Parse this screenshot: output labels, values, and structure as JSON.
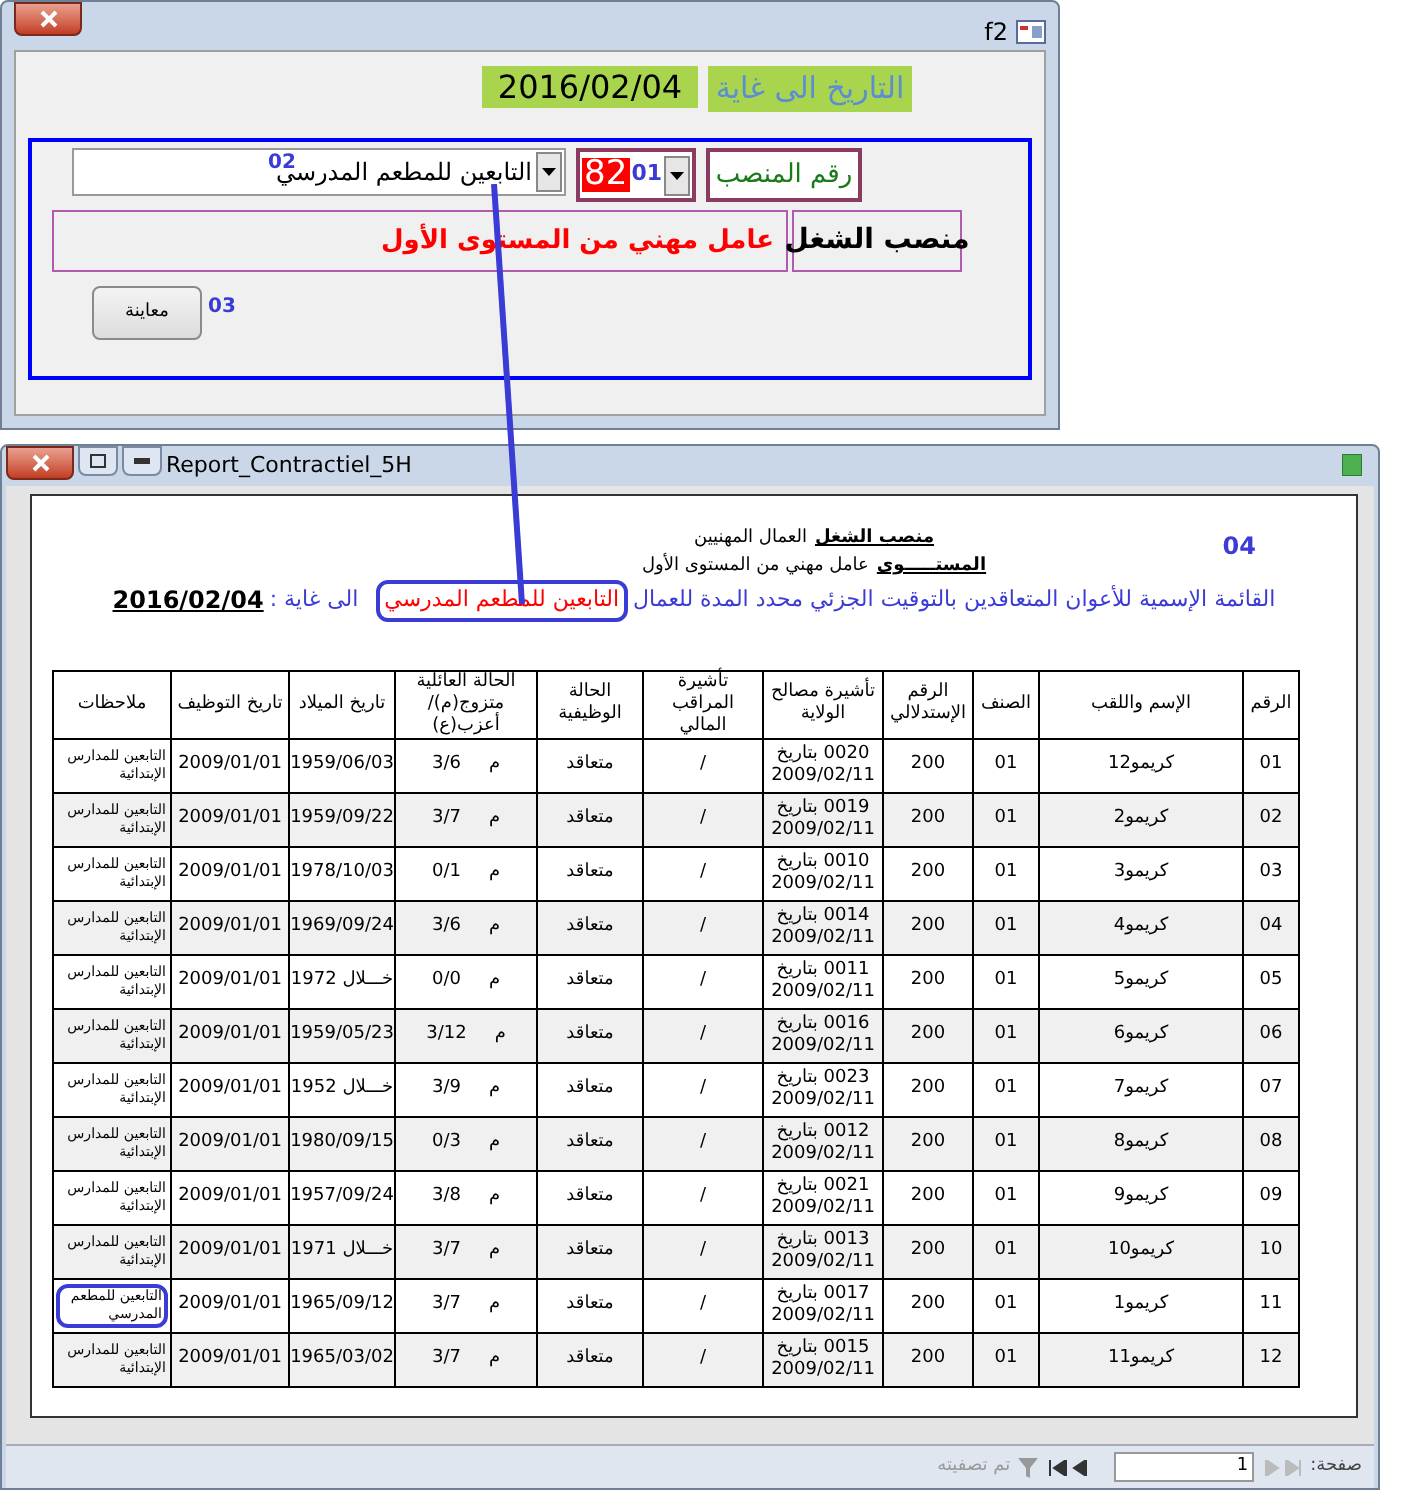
{
  "form_window": {
    "title": "f2",
    "date_label": "التاريخ الى غاية",
    "date": "2016/02/04",
    "post_number_label": "رقم المنصب",
    "post_number": "82",
    "post_code": "01",
    "category": "التابعين للمطعم المدرسي",
    "marker_category": "02",
    "job_label": "منصب الشغل",
    "job_value": "عامل مهني من المستوى الأول",
    "preview_button": "معاينة",
    "marker_button": "03"
  },
  "report_window": {
    "title": "Report_Contractiel_5H",
    "marker": "04",
    "header_lines": [
      {
        "label": "منصب الشغل",
        "value": "العمال المهنيين"
      },
      {
        "label": "المستـــــوى",
        "value": "عامل مهني من المستوى الأول"
      }
    ],
    "list_title": "القائمة الإسمية للأعوان المتعاقدين بالتوقيت الجزئي محدد المدة للعمال",
    "list_category": "التابعين للمطعم المدرسي",
    "category_highlighted": true,
    "until_label": "الى غاية :",
    "until_date": "2016/02/04",
    "table": {
      "columns": [
        "الرقم",
        "الإسم واللقب",
        "الصنف",
        "الرقم الإستدلالي",
        "تأشيرة مصالح الولاية",
        "تأشيرة المراقب المالي",
        "الحالة الوظيفية",
        "الحالة العائلية متزوج(م)/أعزب(ع)",
        "تاريخ الميلاد",
        "تاريخ التوظيف",
        "ملاحظات"
      ],
      "rows": [
        {
          "number": "01",
          "name": "كريمو12",
          "class": "01",
          "index": "200",
          "visa_wilaya": "0020 بتاريخ 2009/02/11",
          "visa_finance": "/",
          "status": "متعاقد",
          "marital": "م",
          "children": "3/6",
          "birth": "1959/06/03",
          "hired": "2009/01/01",
          "notes": "التابعين للمدارس الإبتدائية",
          "shaded": false,
          "highlighted": false
        },
        {
          "number": "02",
          "name": "كريمو2",
          "class": "01",
          "index": "200",
          "visa_wilaya": "0019 بتاريخ 2009/02/11",
          "visa_finance": "/",
          "status": "متعاقد",
          "marital": "م",
          "children": "3/7",
          "birth": "1959/09/22",
          "hired": "2009/01/01",
          "notes": "التابعين للمدارس الإبتدائية",
          "shaded": true,
          "highlighted": false
        },
        {
          "number": "03",
          "name": "كريمو3",
          "class": "01",
          "index": "200",
          "visa_wilaya": "0010 بتاريخ 2009/02/11",
          "visa_finance": "/",
          "status": "متعاقد",
          "marital": "م",
          "children": "0/1",
          "birth": "1978/10/03",
          "hired": "2009/01/01",
          "notes": "التابعين للمدارس الإبتدائية",
          "shaded": false,
          "highlighted": false
        },
        {
          "number": "04",
          "name": "كريمو4",
          "class": "01",
          "index": "200",
          "visa_wilaya": "0014 بتاريخ 2009/02/11",
          "visa_finance": "/",
          "status": "متعاقد",
          "marital": "م",
          "children": "3/6",
          "birth": "1969/09/24",
          "hired": "2009/01/01",
          "notes": "التابعين للمدارس الإبتدائية",
          "shaded": true,
          "highlighted": false
        },
        {
          "number": "05",
          "name": "كريمو5",
          "class": "01",
          "index": "200",
          "visa_wilaya": "0011 بتاريخ 2009/02/11",
          "visa_finance": "/",
          "status": "متعاقد",
          "marital": "م",
          "children": "0/0",
          "birth": "خـــلال 1972",
          "hired": "2009/01/01",
          "notes": "التابعين للمدارس الإبتدائية",
          "shaded": false,
          "highlighted": false
        },
        {
          "number": "06",
          "name": "كريمو6",
          "class": "01",
          "index": "200",
          "visa_wilaya": "0016 بتاريخ 2009/02/11",
          "visa_finance": "/",
          "status": "متعاقد",
          "marital": "م",
          "children": "3/12",
          "birth": "1959/05/23",
          "hired": "2009/01/01",
          "notes": "التابعين للمدارس الإبتدائية",
          "shaded": true,
          "highlighted": false
        },
        {
          "number": "07",
          "name": "كريمو7",
          "class": "01",
          "index": "200",
          "visa_wilaya": "0023 بتاريخ 2009/02/11",
          "visa_finance": "/",
          "status": "متعاقد",
          "marital": "م",
          "children": "3/9",
          "birth": "خـــلال 1952",
          "hired": "2009/01/01",
          "notes": "التابعين للمدارس الإبتدائية",
          "shaded": false,
          "highlighted": false
        },
        {
          "number": "08",
          "name": "كريمو8",
          "class": "01",
          "index": "200",
          "visa_wilaya": "0012 بتاريخ 2009/02/11",
          "visa_finance": "/",
          "status": "متعاقد",
          "marital": "م",
          "children": "0/3",
          "birth": "1980/09/15",
          "hired": "2009/01/01",
          "notes": "التابعين للمدارس الإبتدائية",
          "shaded": true,
          "highlighted": false
        },
        {
          "number": "09",
          "name": "كريمو9",
          "class": "01",
          "index": "200",
          "visa_wilaya": "0021 بتاريخ 2009/02/11",
          "visa_finance": "/",
          "status": "متعاقد",
          "marital": "م",
          "children": "3/8",
          "birth": "1957/09/24",
          "hired": "2009/01/01",
          "notes": "التابعين للمدارس الإبتدائية",
          "shaded": false,
          "highlighted": false
        },
        {
          "number": "10",
          "name": "كريمو10",
          "class": "01",
          "index": "200",
          "visa_wilaya": "0013 بتاريخ 2009/02/11",
          "visa_finance": "/",
          "status": "متعاقد",
          "marital": "م",
          "children": "3/7",
          "birth": "خـــلال 1971",
          "hired": "2009/01/01",
          "notes": "التابعين للمدارس الإبتدائية",
          "shaded": true,
          "highlighted": false
        },
        {
          "number": "11",
          "name": "كريمو1",
          "class": "01",
          "index": "200",
          "visa_wilaya": "0017 بتاريخ 2009/02/11",
          "visa_finance": "/",
          "status": "متعاقد",
          "marital": "م",
          "children": "3/7",
          "birth": "1965/09/12",
          "hired": "2009/01/01",
          "notes": "التابعين للمطعم المدرسي",
          "shaded": false,
          "highlighted": true
        },
        {
          "number": "12",
          "name": "كريمو11",
          "class": "01",
          "index": "200",
          "visa_wilaya": "0015 بتاريخ 2009/02/11",
          "visa_finance": "/",
          "status": "متعاقد",
          "marital": "م",
          "children": "3/7",
          "birth": "1965/03/02",
          "hired": "2009/01/01",
          "notes": "التابعين للمدارس الإبتدائية",
          "shaded": true,
          "highlighted": false
        }
      ]
    },
    "status_bar": {
      "page_label": "صفحة:",
      "page": "1",
      "filter": "تم تصفيته"
    }
  }
}
